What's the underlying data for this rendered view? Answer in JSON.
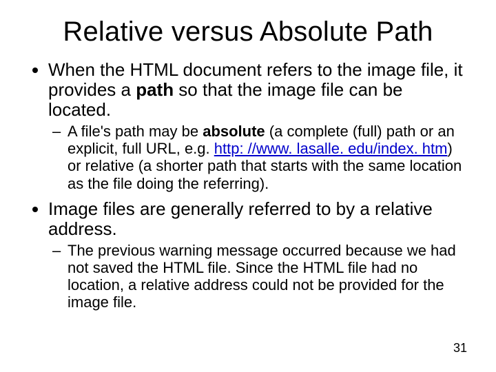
{
  "title": "Relative versus Absolute Path",
  "bullets": {
    "b1": {
      "pre": "When the HTML document refers to the image file, it provides a ",
      "bold": "path",
      "post": " so that the image file can be located.",
      "sub": {
        "pre": "A file's path may be ",
        "bold": "absolute",
        "mid": " (a complete (full) path or an explicit, full URL, e.g. ",
        "link_text": "http: //www. lasalle. edu/index. htm",
        "post": ") or relative (a shorter path that starts with the same location as the file doing the referring)."
      }
    },
    "b2": {
      "text": "Image files are generally referred to by a relative address.",
      "sub": {
        "text": "The previous warning message occurred because we had not saved the HTML file.  Since the HTML file had no location, a relative address could not be provided for the image file."
      }
    }
  },
  "page_number": "31"
}
